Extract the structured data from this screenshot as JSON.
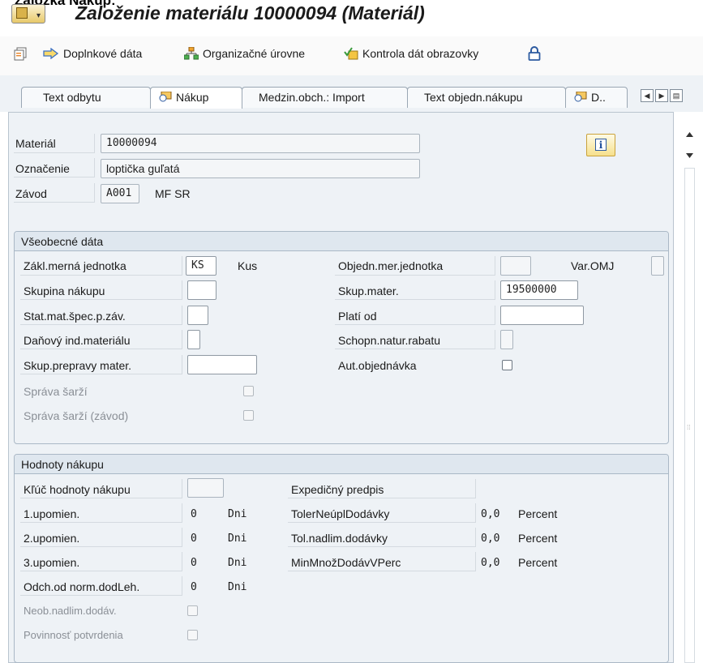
{
  "window": {
    "caption": "Záložka Nákup:",
    "title": "Založenie materiálu 10000094 (Materiál)"
  },
  "toolbar": {
    "additional_data": "Doplnkové dáta",
    "org_levels": "Organizačné úrovne",
    "check_screen": "Kontrola dát obrazovky",
    "icons": [
      "copy-icon",
      "arrow-right-icon",
      "org-structure-icon",
      "check-data-icon",
      "lock-icon"
    ]
  },
  "tabs": [
    {
      "label": "Text odbytu"
    },
    {
      "label": "Nákup",
      "active": true
    },
    {
      "label": "Medzin.obch.: Import"
    },
    {
      "label": "Text objedn.nákupu"
    },
    {
      "label": "D.."
    }
  ],
  "header_fields": {
    "material_label": "Materiál",
    "material_value": "10000094",
    "desc_label": "Označenie",
    "desc_value": "loptička guľatá",
    "plant_label": "Závod",
    "plant_value": "A001",
    "plant_name": "MF SR"
  },
  "general": {
    "title": "Všeobecné dáta",
    "base_uom_label": "Zákl.merná jednotka",
    "base_uom_value": "KS",
    "base_uom_text": "Kus",
    "purch_group_label": "Skupina nákupu",
    "plant_status_label": "Stat.mat.špec.p.záv.",
    "tax_ind_label": "Daňový ind.materiálu",
    "transport_group_label": "Skup.prepravy mater.",
    "batch_mgmt_label": "Správa šarží",
    "batch_mgmt_plant_label": "Správa šarží (závod)",
    "order_unit_label": "Objedn.mer.jednotka",
    "var_uom_label": "Var.OMJ",
    "mat_group_label": "Skup.mater.",
    "mat_group_value": "19500000",
    "valid_from_label": "Platí od",
    "natural_discount_label": "Schopn.natur.rabatu",
    "auto_po_label": "Aut.objednávka"
  },
  "purchasing": {
    "title": "Hodnoty nákupu",
    "key_label": "Kľúč hodnoty nákupu",
    "shipping_instr_label": "Expedičný predpis",
    "reminders": [
      {
        "label": "1.upomien.",
        "value": "0",
        "unit": "Dni"
      },
      {
        "label": "2.upomien.",
        "value": "0",
        "unit": "Dni"
      },
      {
        "label": "3.upomien.",
        "value": "0",
        "unit": "Dni"
      },
      {
        "label": "Odch.od norm.dodLeh.",
        "value": "0",
        "unit": "Dni"
      }
    ],
    "tolerances": [
      {
        "label": "TolerNeúplDodávky",
        "value": "0,0",
        "unit": "Percent"
      },
      {
        "label": "Tol.nadlim.dodávky",
        "value": "0,0",
        "unit": "Percent"
      },
      {
        "label": "MinMnožDodávVPerc",
        "value": "0,0",
        "unit": "Percent"
      }
    ],
    "unlimited_overdelivery_label": "Neob.nadlim.dodáv.",
    "ack_required_label": "Povinnosť potvrdenia"
  }
}
